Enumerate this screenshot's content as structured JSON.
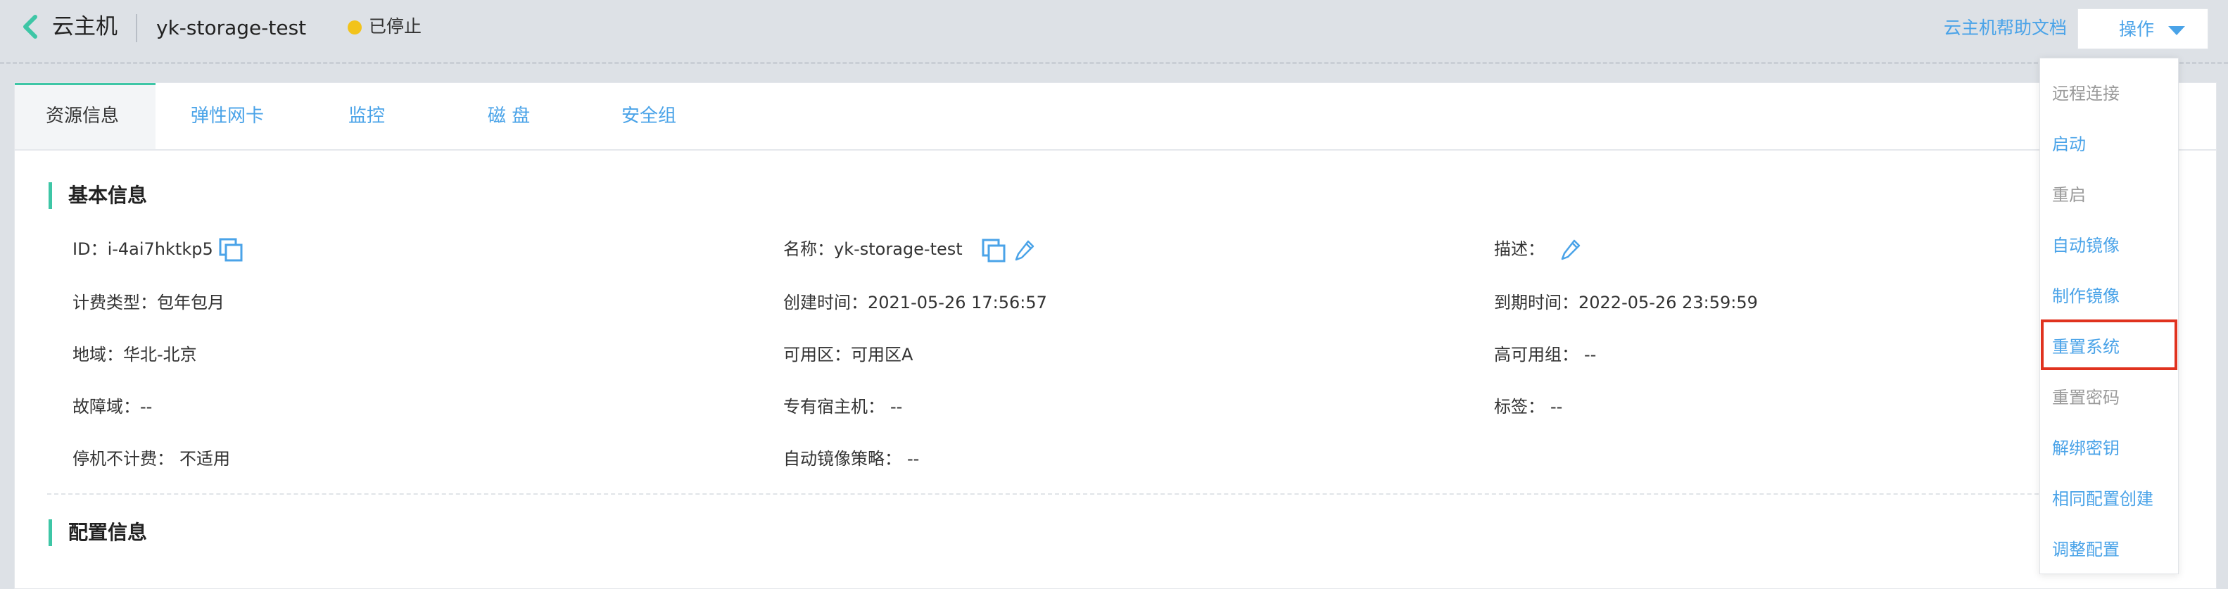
{
  "header": {
    "title": "云主机",
    "instance_name": "yk-storage-test",
    "status": "已停止",
    "help_link": "云主机帮助文档",
    "operations_button": "操作"
  },
  "colors": {
    "accent": "#4aa3e8",
    "section_bar": "#3ec6a6",
    "status_stopped": "#f2c31b",
    "highlight": "#e0321e"
  },
  "tabs": [
    {
      "label": "资源信息",
      "active": true
    },
    {
      "label": "弹性网卡",
      "active": false
    },
    {
      "label": "监控",
      "active": false
    },
    {
      "label": "磁 盘",
      "active": false
    },
    {
      "label": "安全组",
      "active": false
    }
  ],
  "basic_info": {
    "title": "基本信息",
    "id": {
      "label": "ID：",
      "value": "i-4ai7hktkp5"
    },
    "name": {
      "label": "名称：",
      "value": "yk-storage-test"
    },
    "description": {
      "label": "描述："
    },
    "billing_type": {
      "label": "计费类型：",
      "value": "包年包月"
    },
    "created_time": {
      "label": "创建时间：",
      "value": "2021-05-26 17:56:57"
    },
    "expire_time": {
      "label": "到期时间：",
      "value": "2022-05-26 23:59:59"
    },
    "region": {
      "label": "地域：",
      "value": "华北-北京"
    },
    "availability_zone": {
      "label": "可用区：",
      "value": "可用区A"
    },
    "ha_group": {
      "label": "高可用组：",
      "value": "--"
    },
    "fault_domain": {
      "label": "故障域：",
      "value": "--"
    },
    "dedicated_host": {
      "label": "专有宿主机：",
      "value": "--"
    },
    "tags": {
      "label": "标签：",
      "value": "--"
    },
    "stop_no_charge": {
      "label": "停机不计费：",
      "value": "不适用"
    },
    "auto_image_policy": {
      "label": "自动镜像策略：",
      "value": "--"
    }
  },
  "config_info": {
    "title": "配置信息"
  },
  "dropdown": {
    "items": [
      {
        "label": "远程连接",
        "enabled": false
      },
      {
        "label": "启动",
        "enabled": true
      },
      {
        "label": "重启",
        "enabled": false
      },
      {
        "label": "自动镜像",
        "enabled": true
      },
      {
        "label": "制作镜像",
        "enabled": true
      },
      {
        "label": "重置系统",
        "enabled": true,
        "highlighted": true
      },
      {
        "label": "重置密码",
        "enabled": false
      },
      {
        "label": "解绑密钥",
        "enabled": true
      },
      {
        "label": "相同配置创建",
        "enabled": true
      },
      {
        "label": "调整配置",
        "enabled": true
      }
    ]
  }
}
